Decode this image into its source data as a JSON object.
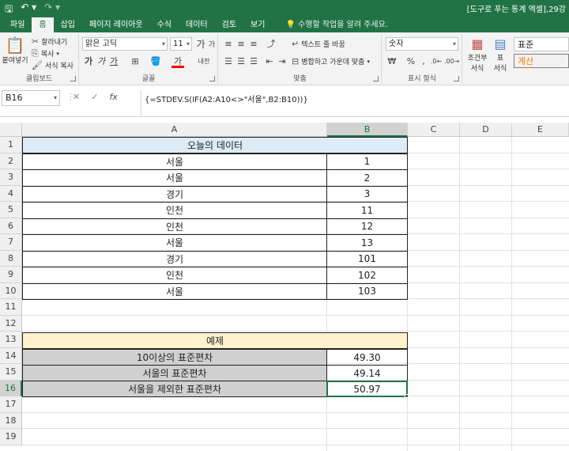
{
  "window": {
    "title": "[도구로 푸는 통계 엑셀],29강",
    "qat": {
      "save_icon": "save-icon",
      "undo_icon": "undo-icon",
      "redo_icon": "redo-icon"
    }
  },
  "tabs": [
    "파일",
    "홈",
    "삽입",
    "페이지 레이아웃",
    "수식",
    "데이터",
    "검토",
    "보기"
  ],
  "active_tab": "홈",
  "tell_me": "수행할 작업을 알려 주세요.",
  "ribbon": {
    "clipboard": {
      "paste": "붙여넣기",
      "cut": "잘라내기",
      "copy": "복사",
      "format_painter": "서식 복사",
      "label": "클립보드"
    },
    "font": {
      "name": "맑은 고딕",
      "size": "11",
      "grow": "가",
      "shrink": "가",
      "bold": "가",
      "italic": "가",
      "underline": "가",
      "font_color": "가",
      "phonetic": "내천",
      "label": "글꼴",
      "accent": "#ff0000"
    },
    "alignment": {
      "wrap": "텍스트 줄 바꿈",
      "merge": "병합하고 가운데 맞춤",
      "label": "맞춤"
    },
    "number": {
      "format": "숫자",
      "percent": "%",
      "comma": ",",
      "label": "표시 형식"
    },
    "styles": {
      "conditional": "조건부",
      "conditional_2": "서식",
      "table": "표",
      "table_2": "서식",
      "normal": "표준",
      "calc": "계산"
    }
  },
  "formula_bar": {
    "name_box": "B16",
    "cancel": "✕",
    "enter": "✓",
    "fx": "fx",
    "formula": "{=STDEV.S(IF(A2:A10<>\"서울\",B2:B10))}"
  },
  "columns": [
    "A",
    "B",
    "C",
    "D",
    "E"
  ],
  "rows": [
    "1",
    "2",
    "3",
    "4",
    "5",
    "6",
    "7",
    "8",
    "9",
    "10",
    "11",
    "12",
    "13",
    "14",
    "15",
    "16",
    "17",
    "18",
    "19"
  ],
  "sheet": {
    "title": "오늘의 데이터",
    "data": [
      {
        "city": "서울",
        "value": "1"
      },
      {
        "city": "서울",
        "value": "2"
      },
      {
        "city": "경기",
        "value": "3"
      },
      {
        "city": "인천",
        "value": "11"
      },
      {
        "city": "인천",
        "value": "12"
      },
      {
        "city": "서울",
        "value": "13"
      },
      {
        "city": "경기",
        "value": "101"
      },
      {
        "city": "인천",
        "value": "102"
      },
      {
        "city": "서울",
        "value": "103"
      }
    ],
    "example_title": "예제",
    "results": [
      {
        "label": "10이상의 표준편차",
        "value": "49.30"
      },
      {
        "label": "서울의 표준편차",
        "value": "49.14"
      },
      {
        "label": "서울을 제외한 표준편차",
        "value": "50.97"
      }
    ]
  },
  "colors": {
    "brand": "#217346",
    "title_fill": "#ddebf7",
    "example_fill": "#fff2cc",
    "result_fill": "#d0d0d0"
  }
}
